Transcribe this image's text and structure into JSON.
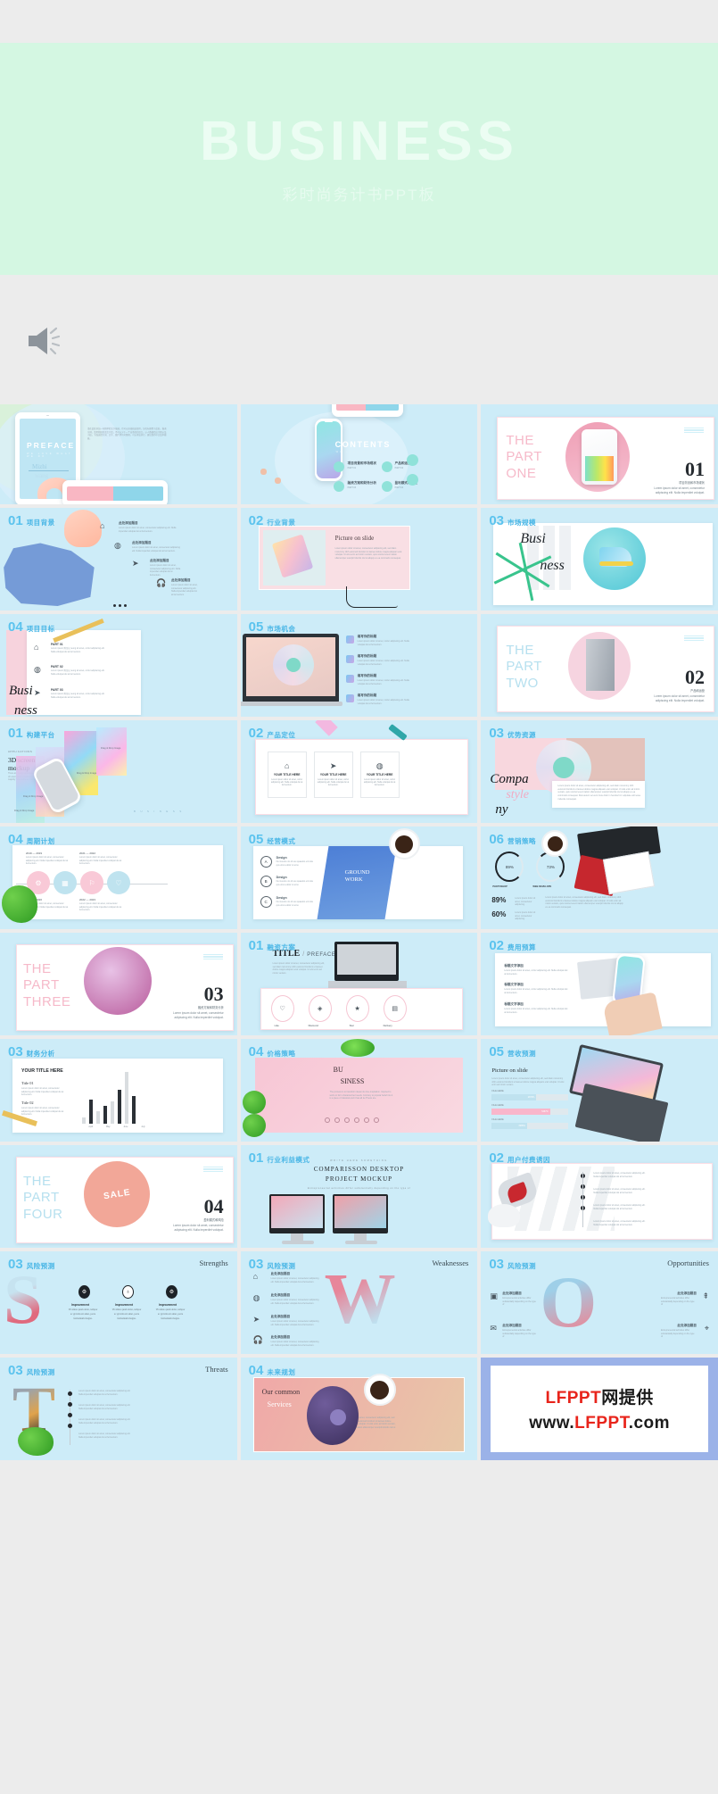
{
  "hero": {
    "title": "BUSINESS",
    "subtitle": "彩时尚务计书PPT板",
    "bg_color": "#d4f7e2",
    "title_color": "#ecfdf3"
  },
  "player": {
    "speaker_icon": "speaker-icon"
  },
  "theme": {
    "slide_bg": "#cdecf8",
    "accent_blue": "#5bc3ee",
    "accent_pink": "#f6c6d3",
    "page_bg": "#ececec"
  },
  "slides": [
    {
      "id": "preface",
      "num": "",
      "cn": "",
      "corner": "",
      "title": "PREFACE",
      "sub": "WE LOVE WHAT WE DO",
      "script1": "Mizhi",
      "script2": "wang",
      "body": "请在此处添加一句简单的文字描述，也可以直接粘贴使用，分段标题置于此处。描述示例，请用简短的语言介绍，不可以少于一个自然段的语言。以人数据给出引题以及小结，下面这提示词、文字、图片等均可替换。可以多加多行。建议保持中文及本模板。"
    },
    {
      "id": "contents",
      "num": "",
      "cn": "",
      "corner": "",
      "title": "CONTENTS",
      "sub": "WE LOVE WHAT WE DO",
      "items": [
        {
          "label": "项目背景和市场现状",
          "sub": "PART 01"
        },
        {
          "label": "产品和运营",
          "sub": "PART 02"
        },
        {
          "label": "融资方案和财务分析",
          "sub": "PART 03"
        },
        {
          "label": "盈利模式和风险",
          "sub": "PART 04"
        }
      ]
    },
    {
      "id": "part-one",
      "num": "",
      "cn": "",
      "corner": "",
      "part": "THE\nPART\nONE",
      "bignum": "01",
      "cn_cap": "项目背景和市场现状",
      "cap": "Lorem ipsum dolor sit amet, consectetur adipiscing elit. Nulla imperdiet volutpat."
    },
    {
      "id": "background",
      "num": "01",
      "cn": "项目背景",
      "corner": "",
      "items": [
        {
          "icon": "home-icon",
          "title": "此处添加题目",
          "text": "Lorem ipsum dolor sit amet, consectetur adipiscing elit. Nulla imperdiet volutpat dui at fermentum."
        },
        {
          "icon": "lifebuoy-icon",
          "title": "此处添加题目",
          "text": "Lorem ipsum dolor sit amet, consectetur adipiscing elit. Nulla imperdiet volutpat dui at fermentum."
        },
        {
          "icon": "paper-plane-icon",
          "title": "此处添加题目",
          "text": "Lorem ipsum dolor sit amet, consectetur adipiscing elit. Nulla imperdiet volutpat dui at fermentum."
        },
        {
          "icon": "headphones-icon",
          "title": "此处添加题目",
          "text": "Lorem ipsum dolor sit amet, consectetur adipiscing elit. Nulla imperdiet volutpat dui at fermentum."
        }
      ],
      "footer": "B U S I N E S S"
    },
    {
      "id": "industry",
      "num": "02",
      "cn": "行业背景",
      "corner": "",
      "title": "Picture on slide",
      "text": "Lorem ipsum dolor sit amet, consectetur adipiscing elit, sed diam nonummy nibh euismod tincidunt ut laoreet dolore magna aliquam erat volutpat. Ut wisi enim ad minim veniam, quis nostrud exerci tation ullamcorper suscipit lobortis nisl ut aliquip ex ea commodo consequat."
    },
    {
      "id": "market-size",
      "num": "03",
      "cn": "市场规模",
      "corner": "",
      "script_a": "Busi",
      "script_b": "ness",
      "vert1": "CLOTHING",
      "vert2": "& STYLE",
      "vert3": "BUY",
      "vert4": "BY",
      "vert5": "FASHION"
    },
    {
      "id": "goal",
      "num": "04",
      "cn": "项目目标",
      "corner": "",
      "script_a": "Busi",
      "script_b": "ness",
      "parts": [
        {
          "label": "PART 01",
          "text": "Lorem ipsum 附全长 leung sit amet, cortur adipiscing elit. Nulla volutpat dui at fermentum."
        },
        {
          "label": "PART 02",
          "text": "Lorem ipsum 附全长 leung sit amet, cortur adipiscing elit. Nulla volutpat dui at fermentum."
        },
        {
          "label": "PART 03",
          "text": "Lorem ipsum 附全长 leung sit amet, cortur adipiscing elit. Nulla volutpat dui at fermentum."
        }
      ]
    },
    {
      "id": "opportunity",
      "num": "05",
      "cn": "市场机会",
      "corner": "",
      "items": [
        {
          "title": "填写你的标题",
          "text": "Lorem ipsum dolor sit amet, cortur adipiscing elit. Nulla volutpat dui at fermentum."
        },
        {
          "title": "填写你的标题",
          "text": "Lorem ipsum dolor sit amet, cortur adipiscing elit. Nulla volutpat dui at fermentum."
        },
        {
          "title": "填写你的标题",
          "text": "Lorem ipsum dolor sit amet, cortur adipiscing elit. Nulla volutpat dui at fermentum."
        },
        {
          "title": "填写你的标题",
          "text": "Lorem ipsum dolor sit amet, cortur adipiscing elit. Nulla volutpat dui at fermentum."
        }
      ]
    },
    {
      "id": "part-two",
      "num": "",
      "cn": "",
      "corner": "",
      "part": "THE\nPART\nTWO",
      "bignum": "02",
      "cn_cap": "产品和运营",
      "cap": "Lorem ipsum dolor sit amet, consectetur adipiscing elit. Nulla imperdiet volutpat."
    },
    {
      "id": "platform",
      "num": "01",
      "cn": "构建平台",
      "corner": "",
      "eyebrow": "APPLICATIONS",
      "title": "3D  screen\nmockup",
      "text": "There are many variations of passages of Lorem Ipsum available, but the majority have suffered alteration.",
      "drop_label": "Drag & Drop  Image",
      "footer": "B U S I N E S S"
    },
    {
      "id": "product-pos",
      "num": "02",
      "cn": "产品定位",
      "corner": "",
      "boxes": [
        {
          "icon": "home-icon",
          "title": "YOUR TITLE HERE",
          "text": "Lorem ipsum dolor sit amet, cortur adipiscing elit. Nulla volutpat dui at fermentum."
        },
        {
          "icon": "paper-plane-icon",
          "title": "YOUR TITLE HERE",
          "text": "Lorem ipsum dolor sit amet, cortur adipiscing elit. Nulla volutpat dui at fermentum."
        },
        {
          "icon": "lifebuoy-icon",
          "title": "YOUR TITLE HERE",
          "text": "Lorem ipsum dolor sit amet, cortur adipiscing elit. Nulla volutpat dui at fermentum."
        }
      ]
    },
    {
      "id": "advantage",
      "num": "03",
      "cn": "优势资源",
      "corner": "",
      "script_a": "Compa",
      "script_b": "style",
      "script_c": "ny",
      "text": "Lorem ipsum dolor sit amet, consectetur adipiscing elit, sed diam nonummy nibh euismod tincidunt ut laoreet dolore magna aliquam erat volutpat. Ut wisi enim ad minim veniam, quis nostrud exerci tation ullamcorper suscipit lobortis nisl ut aliquip ex ea commodo consequat. Duis autem vel eum iriure dolor in hendrerit in vulputate velit esse molestie consequat."
    },
    {
      "id": "schedule",
      "num": "04",
      "cn": "周期计划",
      "corner": "",
      "timeline": [
        {
          "range": "2019 — 2019",
          "icon": "gear-icon",
          "color": "#f8c9d8",
          "text": "Lorem ipsum dolor sit amet, consectetur adipiscing elit. Nulla imperdiet volutpat dui at fermentum."
        },
        {
          "range": "2019 — 2020",
          "icon": "calendar-icon",
          "color": "#bfe2ef",
          "text": "Lorem ipsum dolor sit amet, consectetur adipiscing elit. Nulla imperdiet volutpat dui at fermentum."
        },
        {
          "range": "2021 — 2022",
          "icon": "signpost-icon",
          "color": "#f8c9d8",
          "text": "Lorem ipsum dolor sit amet, consectetur adipiscing elit. Nulla imperdiet volutpat dui at fermentum."
        },
        {
          "range": "2022 — 2023",
          "icon": "heart-icon",
          "color": "#bfe2ef",
          "text": "Lorem ipsum dolor sit amet, consectetur adipiscing elit. Nulla imperdiet volutpat dui at fermentum."
        }
      ]
    },
    {
      "id": "biz-model",
      "num": "05",
      "cn": "经营模式",
      "corner": "",
      "rows": [
        {
          "key": "A",
          "title": "Design",
          "text": "Ne invenire vis id usu quaestio ent tota qui errat a dolor si sono."
        },
        {
          "key": "B",
          "title": "Design",
          "text": "Ne invenire vis id usu quaestio ent tota qui errat a dolor si sono."
        },
        {
          "key": "C",
          "title": "Design",
          "text": "Ne invenire vis id usu quaestio ent tota qui errat a dolor si sono."
        }
      ],
      "overlay": "GROUND\nWORK"
    },
    {
      "id": "marketing",
      "num": "06",
      "cn": "营销策略",
      "corner": "",
      "rings": [
        {
          "value": "89%",
          "label": "PHOTOSHOP"
        },
        {
          "value": "73%",
          "label": "WEB DEVELOPE"
        }
      ],
      "stats": [
        {
          "value": "89%",
          "label": "Lorem ipsum dolor sit amet, consectetur adipiscing."
        },
        {
          "value": "60%",
          "label": "Lorem ipsum dolor sit amet, consectetur adipiscing."
        }
      ],
      "text": "Lorem ipsum dolor sit amet, consectetur adipiscing elit, sed diam nonummy nibh euismod tincidunt ut laoreet dolore magna aliquam erat volutpat. Ut wisi enim ad minim veniam, quis nostrud exerci tation ullamcorper suscipit lobortis nisl ut aliquip ex ea commodo consequat."
    },
    {
      "id": "part-three",
      "num": "",
      "cn": "",
      "corner": "",
      "part": "THE\nPART\nTHREE",
      "bignum": "03",
      "cn_cap": "融资方案和财务分析",
      "cap": "Lorem ipsum dolor sit amet, consectetur adipiscing elit. Nulla imperdiet volutpat."
    },
    {
      "id": "financing",
      "num": "01",
      "cn": "融资方案",
      "corner": "",
      "title": "TITLE",
      "title_sep": "/",
      "title_sub": "PREFACE",
      "text": "Lorem ipsum dolor sit amet, consectetur adipiscing elit, sed diam nonummy nibh euismod tincidunt ut laoreet dolore magna aliquam erat volutpat. Ut wisi enim ad minim veniam.",
      "icons": [
        {
          "icon": "heart-icon",
          "label": "Like",
          "text": "Lorem ipsum dolor sit amet consectetur adipiscing elit"
        },
        {
          "icon": "diamond-icon",
          "label": "Diamond",
          "text": "Lorem ipsum dolor sit amet consectetur adipiscing elit"
        },
        {
          "icon": "star-icon",
          "label": "Star",
          "text": "Lorem ipsum dolor sit amet consectetur adipiscing elit"
        },
        {
          "icon": "truck-icon",
          "label": "Delivery",
          "text": "Lorem ipsum dolor sit amet consectetur adipiscing elit"
        }
      ]
    },
    {
      "id": "budget",
      "num": "02",
      "cn": "费用预算",
      "corner": "",
      "items": [
        {
          "title": "标题文字添加",
          "text": "Lorem ipsum dolor sit amet, cortur adipiscing elit. Nulla volutpat dui at fermentum."
        },
        {
          "title": "标题文字添加",
          "text": "Lorem ipsum dolor sit amet, cortur adipiscing elit. Nulla volutpat dui at fermentum."
        },
        {
          "title": "标题文字添加",
          "text": "Lorem ipsum dolor sit amet, cortur adipiscing elit. Nulla volutpat dui at fermentum."
        }
      ]
    },
    {
      "id": "financial",
      "num": "03",
      "cn": "财务分析",
      "corner": "",
      "title": "YOUR TITLE HERE",
      "t1": "Title  01",
      "t1text": "Lorem ipsum dolor sit amet, consectetur adipiscing elit. Nulla imperdiet volutpat dui at fermentum.",
      "t2": "Title  02",
      "t2text": "Lorem ipsum dolor sit amet, consectetur adipiscing elit. Nulla imperdiet volutpat dui at fermentum."
    },
    {
      "id": "pricing",
      "num": "04",
      "cn": "价格策略",
      "corner": "",
      "big1": "BU",
      "big2": "SINESS",
      "text": "The process is to transform ideas into true inspiration. Inspired to work on form characterized needs. Contrary to popular belief into it is a piece of classical and it has all de Thesis are."
    },
    {
      "id": "revenue",
      "num": "05",
      "cn": "营收预测",
      "corner": "",
      "title": "Picture on slide",
      "text": "Lorem ipsum dolor sit amet, consectetur adipiscing elit, sed diam nonummy nibh euismod tincidunt ut laoreet dolore magna aliquam erat volutpat. Ut wisi enim ad minim veniam.",
      "bars": [
        {
          "label": "FILE HERE",
          "value": "2876%",
          "color": "#bfe2ef",
          "pct": 58
        },
        {
          "label": "FILE HERE",
          "value": "5487%",
          "color": "#f9b6cb",
          "pct": 76
        },
        {
          "label": "FILE HERE",
          "value": "3985%",
          "color": "#bfe2ef",
          "pct": 46
        }
      ]
    },
    {
      "id": "part-four",
      "num": "",
      "cn": "",
      "corner": "",
      "part": "THE\nPART\nFOUR",
      "bignum": "04",
      "cn_cap": "盈利模式和风险",
      "cap": "Lorem ipsum dolor sit amet, consectetur adipiscing elit. Nulla imperdiet volutpat."
    },
    {
      "id": "profit-model",
      "num": "01",
      "cn": "行业利益模式",
      "corner": "",
      "eyebrow": "WRITE HERE SOMETHING",
      "title": "COMPARISSON  DESKTOP\nPROJECT  MOCKUP",
      "sub": "Entrepreneurial activities differ substantially depending on the type of"
    },
    {
      "id": "paying",
      "num": "02",
      "cn": "用户付费诱因",
      "corner": "",
      "rows": [
        "Lorem ipsum dolor sit amet, consectetur adipiscing elit. Nulla imperdiet volutpat dui at fermentum.",
        "Lorem ipsum dolor sit amet, consectetur adipiscing elit. Nulla imperdiet volutpat dui at fermentum.",
        "Lorem ipsum dolor sit amet, consectetur adipiscing elit. Nulla imperdiet volutpat dui at fermentum.",
        "Lorem ipsum dolor sit amet, consectetur adipiscing elit. Nulla imperdiet volutpat dui at fermentum."
      ]
    },
    {
      "id": "swot-s",
      "num": "03",
      "cn": "风险预测",
      "corner": "Strengths",
      "letter": "S",
      "cols": [
        {
          "icon": "gear-icon",
          "title": "Improvement",
          "text": "Vivamus quam dolor, tempor ac gravida sit amet, porta fermentum magna."
        },
        {
          "icon": "bulb-icon",
          "title": "Improvement",
          "text": "Vivamus quam dolor, tempor ac gravida sit amet, porta fermentum magna."
        },
        {
          "icon": "gear-icon",
          "title": "Improvement",
          "text": "Vivamus quam dolor, tempor ac gravida sit amet, porta fermentum magna."
        }
      ]
    },
    {
      "id": "swot-w",
      "num": "03",
      "cn": "风险预测",
      "corner": "Weaknesses",
      "letter": "W",
      "items": [
        {
          "icon": "home-icon",
          "title": "此处添加题目",
          "text": "Lorem ipsum dolor sit amet, consectetur adipiscing elit. Nulla imperdiet volutpat dui at fermentum."
        },
        {
          "icon": "lifebuoy-icon",
          "title": "此处添加题目",
          "text": "Lorem ipsum dolor sit amet, consectetur adipiscing elit. Nulla imperdiet volutpat dui at fermentum."
        },
        {
          "icon": "paper-plane-icon",
          "title": "此处添加题目",
          "text": "Lorem ipsum dolor sit amet, consectetur adipiscing elit. Nulla imperdiet volutpat dui at fermentum."
        },
        {
          "icon": "headphones-icon",
          "title": "此处添加题目",
          "text": "Lorem ipsum dolor sit amet, consectetur adipiscing elit. Nulla imperdiet volutpat dui at fermentum."
        }
      ]
    },
    {
      "id": "swot-o",
      "num": "03",
      "cn": "风险预测",
      "corner": "Opportunities",
      "letter": "O",
      "left": [
        {
          "icon": "box-icon",
          "title": "此处添加题目",
          "text": "Entrepreneurial activities differ substantially depending on the type of"
        },
        {
          "icon": "mail-icon",
          "title": "此处添加题目",
          "text": "Entrepreneurial activities differ substantially depending on the type of"
        }
      ],
      "right": [
        {
          "icon": "tree-icon",
          "title": "此处添加题目",
          "text": "Entrepreneurial activities differ substantially depending on the type of"
        },
        {
          "icon": "pin-icon",
          "title": "此处添加题目",
          "text": "Entrepreneurial activities differ substantially depending on the type of"
        }
      ]
    },
    {
      "id": "swot-t",
      "num": "03",
      "cn": "风险预测",
      "corner": "Threats",
      "letter": "T",
      "rows": [
        "Lorem ipsum dolor sit amet, consectetur adipiscing elit. Nulla imperdiet volutpat dui at fermentum.",
        "Lorem ipsum dolor sit amet, consectetur adipiscing elit. Nulla imperdiet volutpat dui at fermentum.",
        "Lorem ipsum dolor sit amet, consectetur adipiscing elit. Nulla imperdiet volutpat dui at fermentum.",
        "Lorem ipsum dolor sit amet, consectetur adipiscing elit. Nulla imperdiet volutpat dui at fermentum."
      ]
    },
    {
      "id": "future",
      "num": "04",
      "cn": "未来规划",
      "corner": "",
      "title_a": "Our common",
      "title_b": "Services",
      "text": "Lorem ipsum dolor sit amet, consectetur adipiscing elit, sed diam nonummy nibh euismod tincidunt ut laoreet dolore magna aliquam erat volutpat. Ut wisi enim ad minim veniam, quis nostrud exerci tation ullamcorper suscipit lobortis nisl ut aliquip ex ea."
    }
  ],
  "watermark": {
    "line1_a": "LFPPT",
    "line1_b": "网提供",
    "line2_a": "www.",
    "line2_b": "LFPPT",
    "line2_c": ".com",
    "red": "#e8241b",
    "dark": "#1b1b1b",
    "frame": "#9bb2e8"
  }
}
